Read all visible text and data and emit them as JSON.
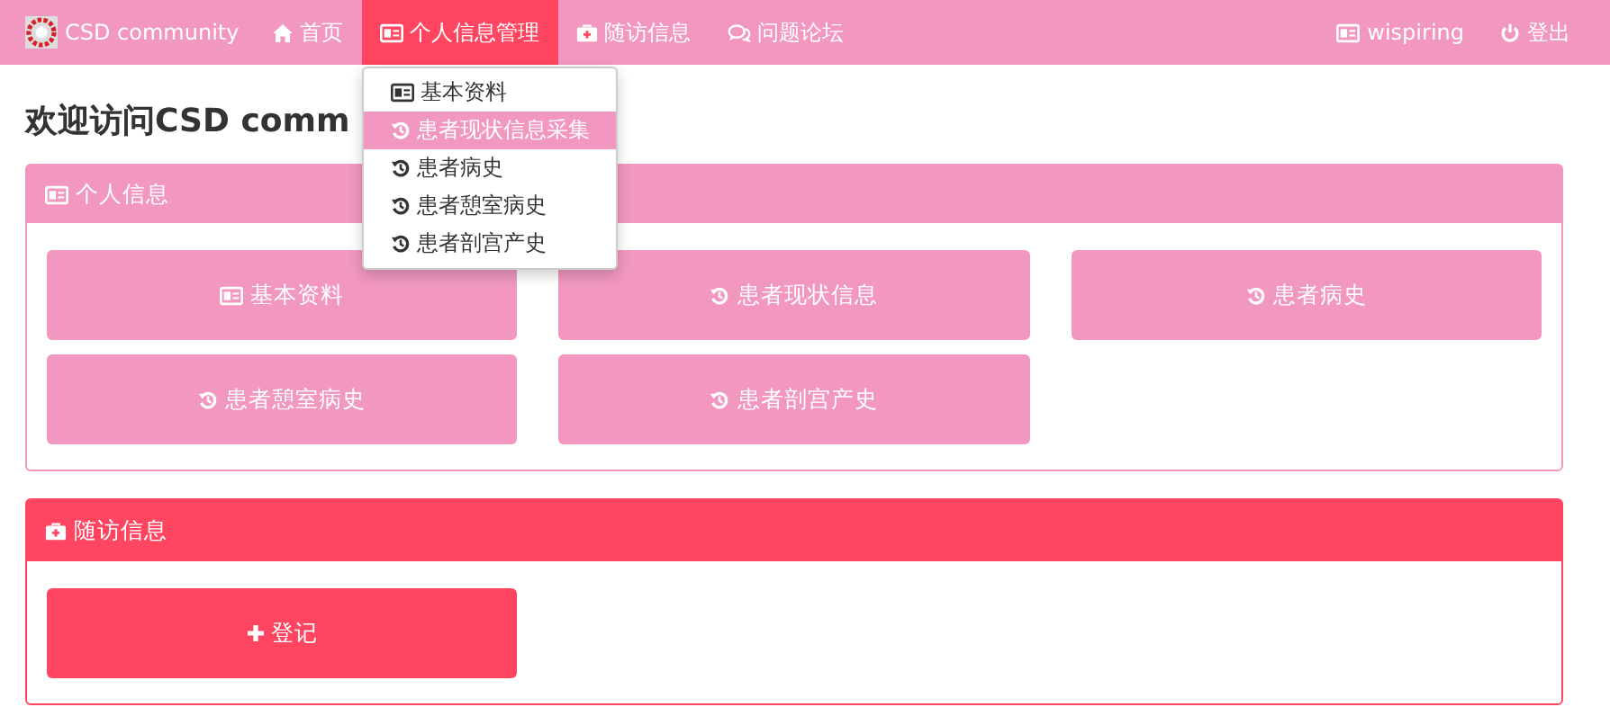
{
  "navbar": {
    "brand": "CSD community",
    "items": [
      {
        "label": "首页",
        "selected": false
      },
      {
        "label": "个人信息管理",
        "selected": true,
        "menu": [
          {
            "label": "基本资料",
            "selected": false
          },
          {
            "label": "患者现状信息采集",
            "selected": true
          },
          {
            "label": "患者病史",
            "selected": false
          },
          {
            "label": "患者憩室病史",
            "selected": false
          },
          {
            "label": "患者剖宫产史",
            "selected": false
          }
        ]
      },
      {
        "label": "随访信息",
        "selected": false
      },
      {
        "label": "问题论坛",
        "selected": false
      }
    ],
    "user": "wispiring",
    "logout": "登出"
  },
  "heading": "欢迎访问CSD comm",
  "panels": [
    {
      "title": "个人信息",
      "buttons": [
        "基本资料",
        "患者现状信息",
        "患者病史",
        "患者憩室病史",
        "患者剖宫产史"
      ]
    },
    {
      "title": "随访信息",
      "buttons": [
        "登记"
      ]
    }
  ]
}
